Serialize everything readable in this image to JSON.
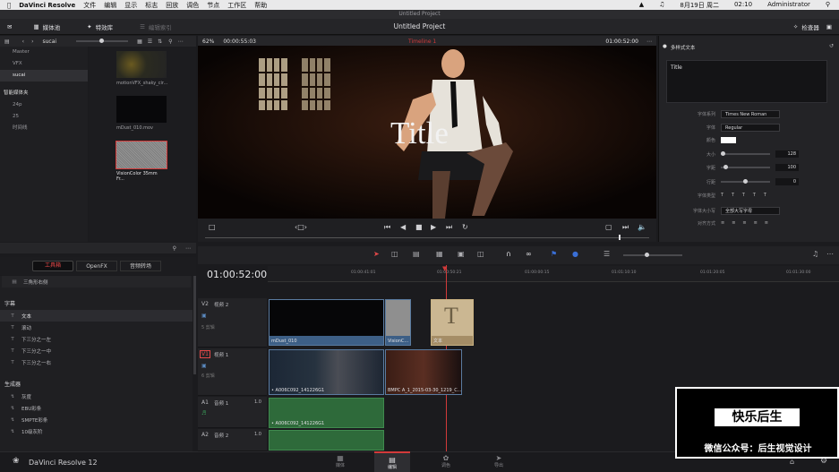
{
  "menubar": {
    "app": "DaVinci Resolve",
    "items": [
      "文件",
      "编辑",
      "显示",
      "标志",
      "回放",
      "调色",
      "节点",
      "工作区",
      "帮助"
    ],
    "date": "8月19日 周二",
    "time": "02:10",
    "user": "Administrator"
  },
  "window": {
    "title": "Untitled Project"
  },
  "toolbar": {
    "media_pool": "媒体池",
    "effects": "特效库",
    "edit_index": "编辑索引",
    "project_title": "Untitled Project",
    "inspector": "检查器"
  },
  "bins": {
    "current": "sucai",
    "items": [
      "Master",
      "VFX",
      "sucai"
    ],
    "smart_bins_label": "智能媒体夹",
    "smart_items": [
      "24p",
      "25",
      "时间线"
    ]
  },
  "clips": [
    {
      "name": "motionVFX_shaky_cir...",
      "color": "#3a3a30"
    },
    {
      "name": "mDust_010.mov",
      "color": "#0a0a0c"
    },
    {
      "name": "VisionColor 35mm Fr...",
      "color": "#8a8a8a"
    }
  ],
  "viewer": {
    "zoom": "62%",
    "source_tc": "00:00:55:03",
    "timeline_name": "Timeline 1",
    "record_tc": "01:00:52:00",
    "title_overlay": "Title"
  },
  "inspector": {
    "section": "多样式文本",
    "text_value": "Title",
    "font_family_label": "字体系列",
    "font_family": "Times New Roman",
    "font_style_label": "字体",
    "font_style": "Regular",
    "color_label": "颜色",
    "size_label": "大小",
    "size": "128",
    "tracking_label": "字距",
    "tracking": "100",
    "line_spacing_label": "行距",
    "line_spacing": "0",
    "font_type_label": "字体类型",
    "case_label": "字体大小写",
    "case_value": "全部大写字母",
    "align_label": "对齐方式"
  },
  "effects_panel": {
    "tabs": [
      "工具箱",
      "OpenFX",
      "音频转场"
    ],
    "prev_item": "三角形右侧",
    "titles_header": "字幕",
    "titles": [
      "文本",
      "滚动",
      "下三分之一左",
      "下三分之一中",
      "下三分之一右"
    ],
    "generators_header": "生成器",
    "generators": [
      "灰度",
      "EBU彩条",
      "SMPTE彩条",
      "10级灰阶"
    ]
  },
  "timeline": {
    "timecode": "01:00:52:00",
    "ruler": [
      "01:00:41:01",
      "01:00:50:21",
      "01:00:00:15",
      "01:01:10:10",
      "01:01:20:05",
      "01:01:30:00"
    ],
    "tracks": [
      {
        "id": "V2",
        "name": "视频 2",
        "count": "5 剪辑"
      },
      {
        "id": "V1",
        "name": "视频 1",
        "count": "6 剪辑"
      },
      {
        "id": "A1",
        "name": "音频 1",
        "level": "1.0"
      },
      {
        "id": "A2",
        "name": "音频 2",
        "level": "1.0"
      }
    ],
    "clips_v2": [
      "mDust_010",
      "VisionC...",
      "文本"
    ],
    "clips_v1": [
      "• A006C092_141226G1",
      "BMPC A_1_2015-03-30_1219_C..."
    ],
    "clips_a1": [
      "• A006C092_141226G1"
    ]
  },
  "footer": {
    "app_version": "DaVinci Resolve 12",
    "pages": [
      "媒体",
      "编辑",
      "调色",
      "导出"
    ]
  },
  "watermark": {
    "title": "快乐后生",
    "subtitle": "微信公众号：后生视觉设计"
  },
  "colors": {
    "accent_red": "#d23a3a",
    "clip_blue": "#3d5f86",
    "audio_green": "#2e6a3a"
  }
}
